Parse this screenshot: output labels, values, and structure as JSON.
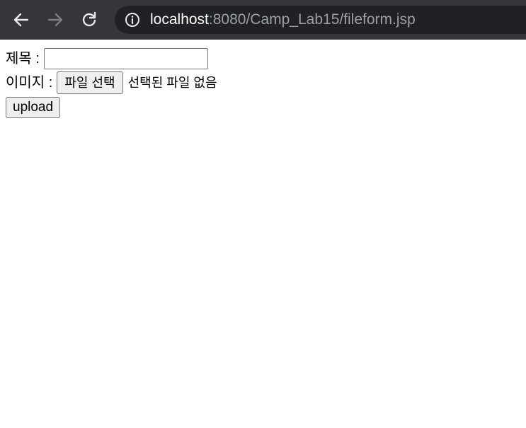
{
  "browser": {
    "url_host": "localhost",
    "url_rest": ":8080/Camp_Lab15/fileform.jsp",
    "icons": {
      "back": "arrow-left-icon",
      "forward": "arrow-right-icon",
      "reload": "reload-icon",
      "info": "info-icon"
    }
  },
  "form": {
    "title_label": "제목 :",
    "title_value": "",
    "image_label": "이미지 :",
    "file_button_label": "파일 선택",
    "file_status": "선택된 파일 없음",
    "upload_label": "upload"
  },
  "colors": {
    "toolbar": "#35363a",
    "omnibox": "#202124",
    "url_dim": "#9aa0a6",
    "url_bright": "#ffffff"
  }
}
